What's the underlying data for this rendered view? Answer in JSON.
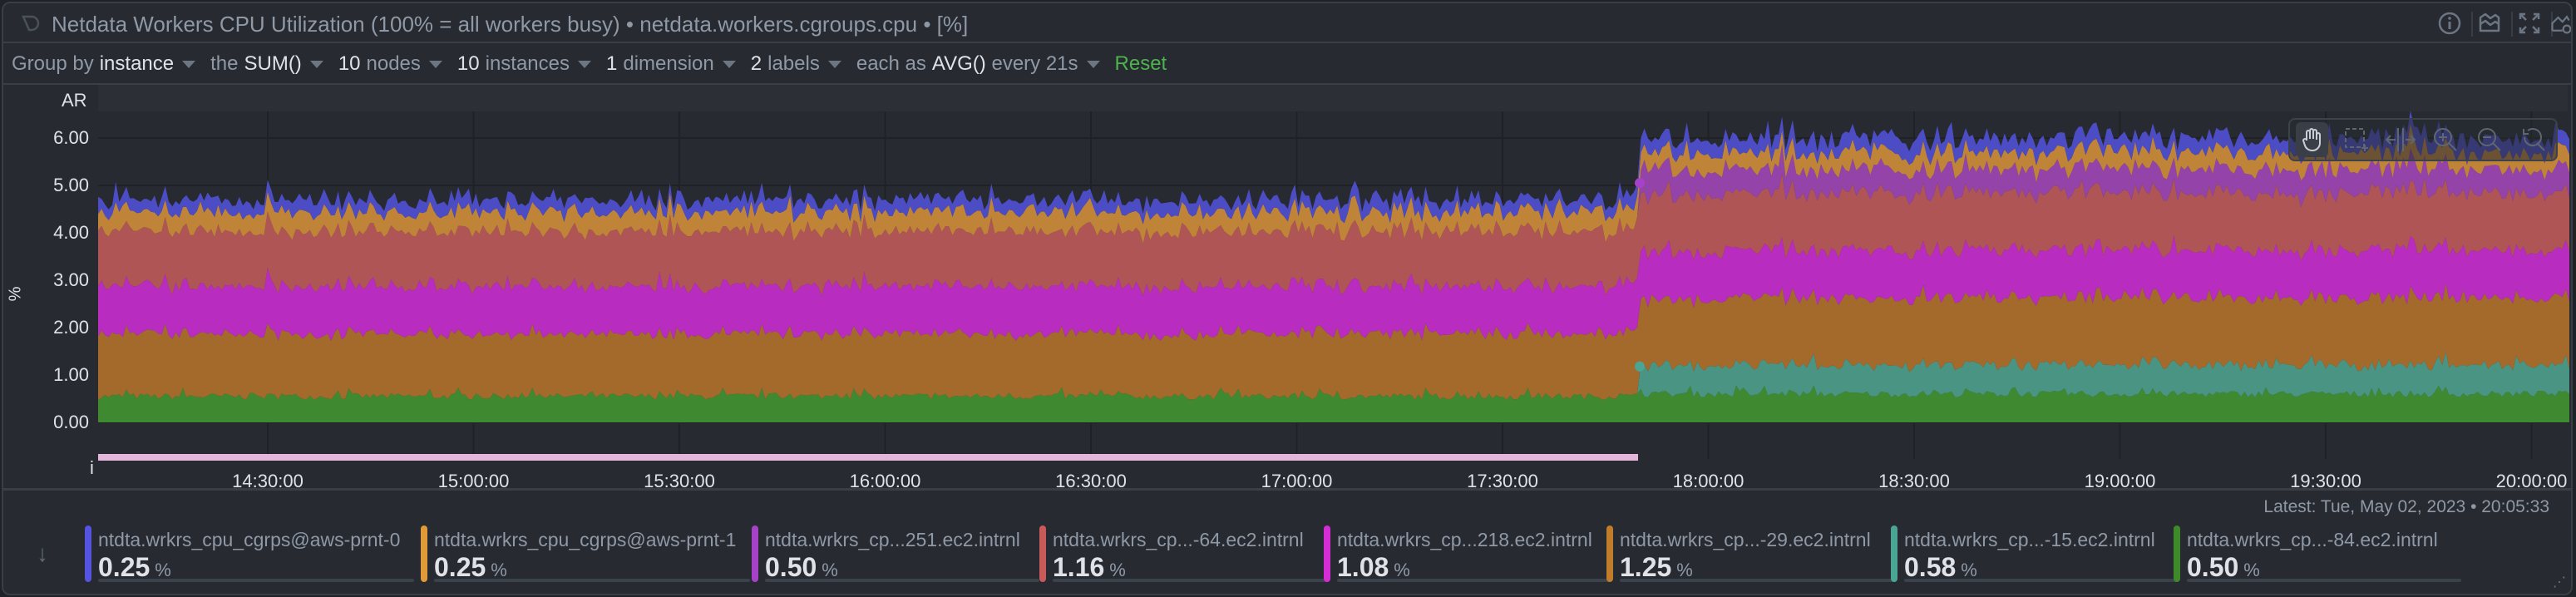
{
  "header": {
    "title": "Netdata Workers CPU Utilization (100% = all workers busy) • netdata.workers.cgroups.cpu • [%]",
    "icons": [
      "netdata-logo-icon",
      "info-icon",
      "chart-type-icon",
      "fullscreen-icon",
      "add-to-dashboard-icon"
    ]
  },
  "toolbar": {
    "group_by_label": "Group by",
    "group_by_value": "instance",
    "agg_label": "the",
    "agg_value": "SUM()",
    "nodes_count": "10",
    "nodes_label": "nodes",
    "instances_count": "10",
    "instances_label": "instances",
    "dimensions_count": "1",
    "dimensions_label": "dimension",
    "labels_count": "2",
    "labels_label": "labels",
    "time_agg_label": "each as",
    "time_agg_value": "AVG()",
    "every_label": "every 21s",
    "reset_label": "Reset"
  },
  "chart": {
    "annotation_row_label": "AR",
    "info_row_label": "i",
    "y_unit": "%",
    "y_ticks": [
      "6.00",
      "5.00",
      "4.00",
      "3.00",
      "2.00",
      "1.00",
      "0.00"
    ],
    "x_ticks": [
      "14:30:00",
      "15:00:00",
      "15:30:00",
      "16:00:00",
      "16:30:00",
      "17:00:00",
      "17:30:00",
      "18:00:00",
      "18:30:00",
      "19:00:00",
      "19:30:00",
      "20:00:00"
    ],
    "nav_tools": [
      "pan-icon",
      "select-zoom-icon",
      "highlight-icon",
      "zoom-in-icon",
      "zoom-out-icon",
      "reset-zoom-icon"
    ],
    "latest_text": "Latest: Tue, May 02, 2023 • 20:05:33"
  },
  "chart_data": {
    "type": "area",
    "stacked": true,
    "ylabel": "%",
    "ylim": [
      0,
      6.5
    ],
    "grid": true,
    "x": [
      "14:05:30",
      "17:49:30",
      "17:50:30",
      "20:05:33"
    ],
    "series": [
      {
        "name": "ntdta.wrkrs_cp...-84.ec2.intrnl",
        "color": "#3f8a31",
        "values": [
          0.55,
          0.55,
          0.6,
          0.6
        ]
      },
      {
        "name": "ntdta.wrkrs_cp...-15.ec2.intrnl",
        "color": "#4a9484",
        "values": [
          0,
          0,
          0.6,
          0.6
        ]
      },
      {
        "name": "ntdta.wrkrs_cp...-29.ec2.intrnl",
        "color": "#a36a2c",
        "values": [
          1.3,
          1.3,
          1.4,
          1.4
        ]
      },
      {
        "name": "ntdta.wrkrs_cp...218.ec2.intrnl",
        "color": "#b92cc0",
        "values": [
          1.0,
          1.0,
          1.0,
          1.0
        ]
      },
      {
        "name": "ntdta.wrkrs_cp...-64.ec2.intrnl",
        "color": "#b05555",
        "values": [
          1.15,
          1.15,
          1.2,
          1.2
        ]
      },
      {
        "name": "ntdta.wrkrs_cp...251.ec2.intrnl",
        "color": "#9444a8",
        "values": [
          0,
          0,
          0.5,
          0.5
        ]
      },
      {
        "name": "ntdta.wrkrs_cpu_cgrps@aws-prnt-1",
        "color": "#bf8438",
        "values": [
          0.4,
          0.4,
          0.35,
          0.35
        ]
      },
      {
        "name": "ntdta.wrkrs_cpu_cgrps@aws-prnt-0",
        "color": "#4c4cc4",
        "values": [
          0.25,
          0.25,
          0.3,
          0.3
        ]
      }
    ]
  },
  "legend": {
    "items": [
      {
        "label": "ntdta.wrkrs_cpu_cgrps@aws-prnt-0",
        "value": "0.25",
        "unit": "%",
        "color": "#5454e0"
      },
      {
        "label": "ntdta.wrkrs_cpu_cgrps@aws-prnt-1",
        "value": "0.25",
        "unit": "%",
        "color": "#e09a38"
      },
      {
        "label": "ntdta.wrkrs_cp...251.ec2.intrnl",
        "value": "0.50",
        "unit": "%",
        "color": "#a642c8"
      },
      {
        "label": "ntdta.wrkrs_cp...-64.ec2.intrnl",
        "value": "1.16",
        "unit": "%",
        "color": "#c85a5a"
      },
      {
        "label": "ntdta.wrkrs_cp...218.ec2.intrnl",
        "value": "1.08",
        "unit": "%",
        "color": "#d62cd6"
      },
      {
        "label": "ntdta.wrkrs_cp...-29.ec2.intrnl",
        "value": "1.25",
        "unit": "%",
        "color": "#c07c28"
      },
      {
        "label": "ntdta.wrkrs_cp...-15.ec2.intrnl",
        "value": "0.58",
        "unit": "%",
        "color": "#4aa595"
      },
      {
        "label": "ntdta.wrkrs_cp...-84.ec2.intrnl",
        "value": "0.50",
        "unit": "%",
        "color": "#3e8a2a"
      }
    ]
  }
}
